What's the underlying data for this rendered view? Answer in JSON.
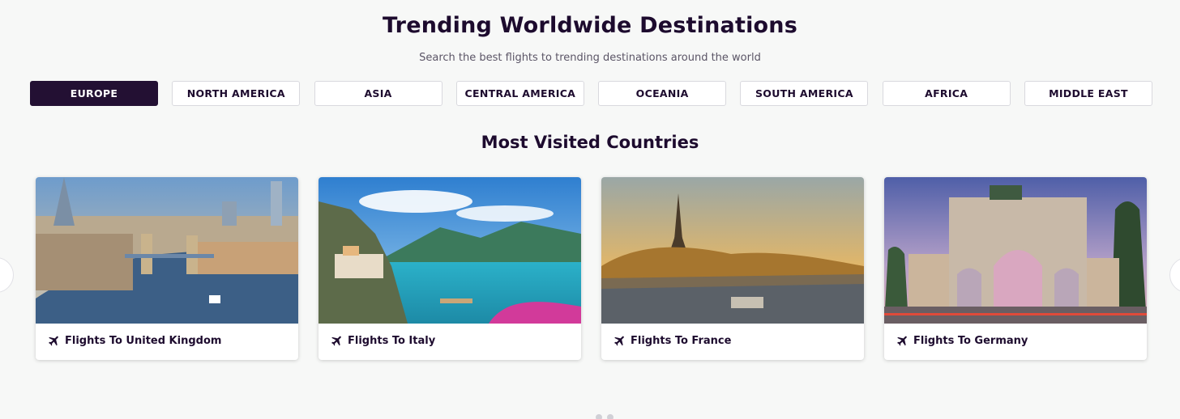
{
  "header": {
    "title": "Trending Worldwide Destinations",
    "subtitle": "Search the best flights to trending destinations around the world"
  },
  "tabs": [
    {
      "label": "EUROPE",
      "active": true
    },
    {
      "label": "NORTH AMERICA",
      "active": false
    },
    {
      "label": "ASIA",
      "active": false
    },
    {
      "label": "CENTRAL AMERICA",
      "active": false
    },
    {
      "label": "OCEANIA",
      "active": false
    },
    {
      "label": "SOUTH AMERICA",
      "active": false
    },
    {
      "label": "AFRICA",
      "active": false
    },
    {
      "label": "MIDDLE EAST",
      "active": false
    }
  ],
  "section": {
    "title": "Most Visited Countries"
  },
  "cards": [
    {
      "label": "Flights To United Kingdom",
      "icon": "airplane-icon"
    },
    {
      "label": "Flights To Italy",
      "icon": "airplane-icon"
    },
    {
      "label": "Flights To France",
      "icon": "airplane-icon"
    },
    {
      "label": "Flights To Germany",
      "icon": "airplane-icon"
    }
  ],
  "colors": {
    "accent": "#231033",
    "text": "#1d0b2e",
    "background": "#f7f8f7"
  }
}
